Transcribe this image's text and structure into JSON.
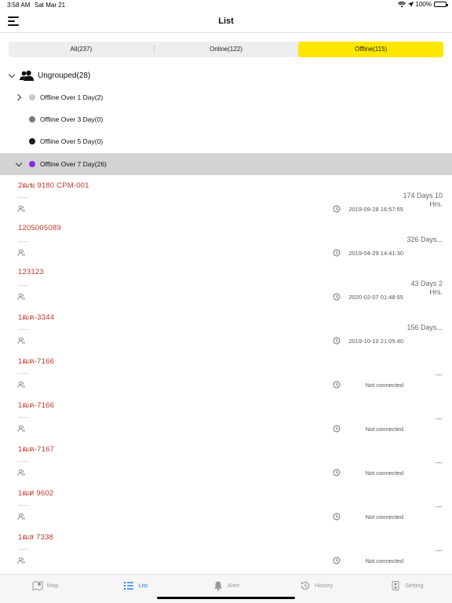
{
  "status": {
    "time": "3:58 AM",
    "date": "Sat Mar 21",
    "battery": "100%"
  },
  "header": {
    "title": "List"
  },
  "segments": [
    {
      "label": "All(237)"
    },
    {
      "label": "Online(122)"
    },
    {
      "label": "Offline(115)"
    }
  ],
  "group": {
    "label": "Ungrouped(28)"
  },
  "subgroups": [
    {
      "label": "Offline Over 1 Day(2)",
      "dot_color": "#c8c8c8"
    },
    {
      "label": "Offline Over 3 Day(0)",
      "dot_color": "#7a7a7a"
    },
    {
      "label": "Offline Over 5 Day(0)",
      "dot_color": "#1a1a1a"
    },
    {
      "label": "Offline Over 7 Day(26)",
      "dot_color": "#8a2be2"
    }
  ],
  "devices": [
    {
      "name": "2ฒฆ 9180 CPM-001",
      "dash": "-----",
      "time": "2019-09-28 16:57:55",
      "duration": "174 Days 10 Hrs."
    },
    {
      "name": "1205005089",
      "dash": "-----",
      "time": "2019-04-29 14:41:30",
      "duration": "326 Days..."
    },
    {
      "name": "123123",
      "dash": "-----",
      "time": "2020-02-07 01:48:55",
      "duration": "43 Days 2 Hrs."
    },
    {
      "name": "1ฒค-3344",
      "dash": "-----",
      "time": "2019-10-10 21:05:40",
      "duration": "156 Days..."
    },
    {
      "name": "1ฒค-7166",
      "dash": "-----",
      "time": "Not connected",
      "duration": "---"
    },
    {
      "name": "1ฒค-7166",
      "dash": "-----",
      "time": "Not connected",
      "duration": "---"
    },
    {
      "name": "1ฒค-7167",
      "dash": "-----",
      "time": "Not connected",
      "duration": "---"
    },
    {
      "name": "1ฒศ 9602",
      "dash": "-----",
      "time": "Not connected",
      "duration": "---"
    },
    {
      "name": "1ฒส 7338",
      "dash": "-----",
      "time": "Not connected",
      "duration": "---"
    }
  ],
  "tabs": [
    {
      "label": "Map",
      "icon": "map-icon"
    },
    {
      "label": "List",
      "icon": "list-icon"
    },
    {
      "label": "Alert",
      "icon": "bell-icon"
    },
    {
      "label": "History",
      "icon": "history-icon"
    },
    {
      "label": "Setting",
      "icon": "setting-icon"
    }
  ],
  "colors": {
    "accent": "#ffe600",
    "device_name": "#c0392b",
    "tab_active": "#1e7cf0"
  }
}
